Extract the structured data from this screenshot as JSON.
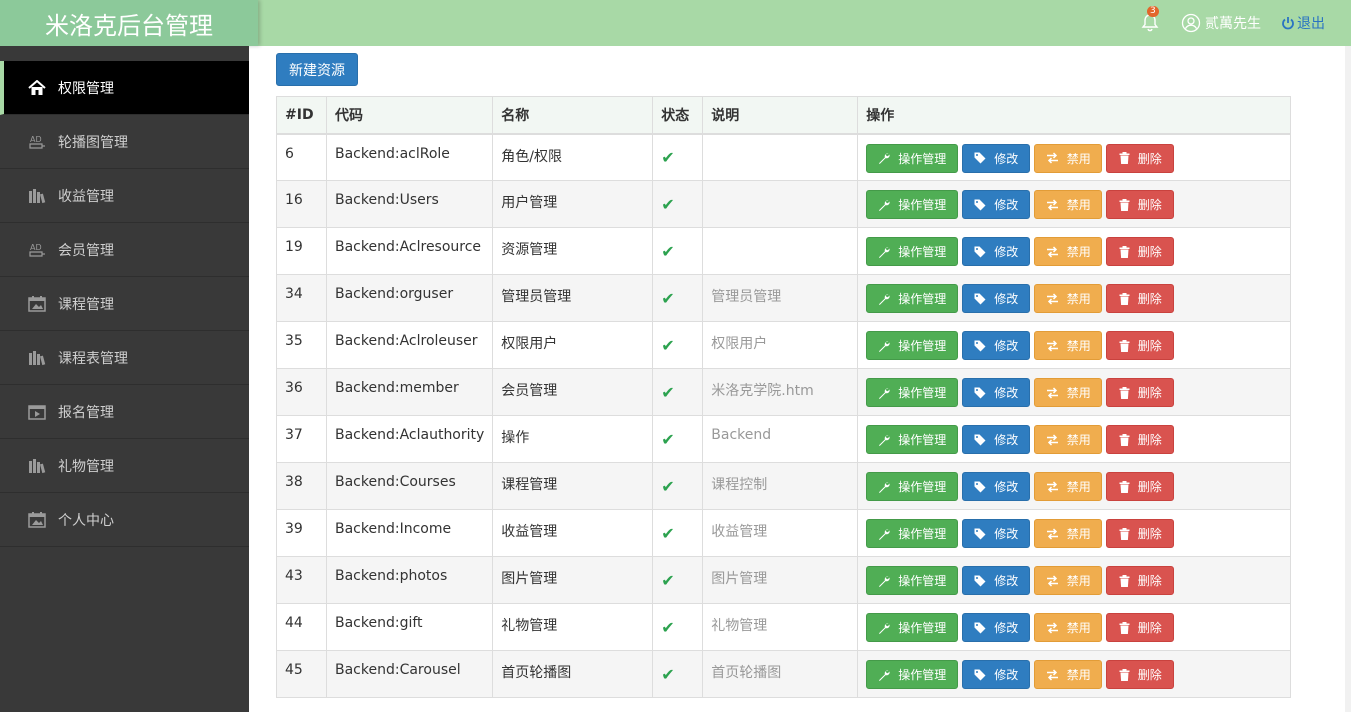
{
  "header": {
    "brand": "米洛克后台管理",
    "notification_count": "3",
    "user_name": "贰萬先生",
    "logout_label": "退出"
  },
  "sidebar": {
    "items": [
      {
        "label": "权限管理",
        "icon": "home-icon",
        "active": true
      },
      {
        "label": "轮播图管理",
        "icon": "ad-icon",
        "active": false
      },
      {
        "label": "收益管理",
        "icon": "library-icon",
        "active": false
      },
      {
        "label": "会员管理",
        "icon": "ad-icon",
        "active": false
      },
      {
        "label": "课程管理",
        "icon": "calendar-icon",
        "active": false
      },
      {
        "label": "课程表管理",
        "icon": "library-icon",
        "active": false
      },
      {
        "label": "报名管理",
        "icon": "video-icon",
        "active": false
      },
      {
        "label": "礼物管理",
        "icon": "library-icon",
        "active": false
      },
      {
        "label": "个人中心",
        "icon": "calendar-icon",
        "active": false
      }
    ]
  },
  "toolbar": {
    "new_label": "新建资源"
  },
  "table": {
    "headers": {
      "id": "#ID",
      "code": "代码",
      "name": "名称",
      "status": "状态",
      "desc": "说明",
      "ops": "操作"
    },
    "actions": {
      "manage": "操作管理",
      "edit": "修改",
      "disable": "禁用",
      "delete": "删除"
    },
    "status_mark": "✔",
    "rows": [
      {
        "id": "6",
        "code": "Backend:aclRole",
        "name": "角色/权限",
        "desc": ""
      },
      {
        "id": "16",
        "code": "Backend:Users",
        "name": "用户管理",
        "desc": ""
      },
      {
        "id": "19",
        "code": "Backend:Aclresource",
        "name": "资源管理",
        "desc": ""
      },
      {
        "id": "34",
        "code": "Backend:orguser",
        "name": "管理员管理",
        "desc": "管理员管理"
      },
      {
        "id": "35",
        "code": "Backend:Aclroleuser",
        "name": "权限用户",
        "desc": "权限用户"
      },
      {
        "id": "36",
        "code": "Backend:member",
        "name": "会员管理",
        "desc": "米洛克学院.htm"
      },
      {
        "id": "37",
        "code": "Backend:Aclauthority",
        "name": "操作",
        "desc": "Backend"
      },
      {
        "id": "38",
        "code": "Backend:Courses",
        "name": "课程管理",
        "desc": "课程控制"
      },
      {
        "id": "39",
        "code": "Backend:Income",
        "name": "收益管理",
        "desc": "收益管理"
      },
      {
        "id": "43",
        "code": "Backend:photos",
        "name": "图片管理",
        "desc": "图片管理"
      },
      {
        "id": "44",
        "code": "Backend:gift",
        "name": "礼物管理",
        "desc": "礼物管理"
      },
      {
        "id": "45",
        "code": "Backend:Carousel",
        "name": "首页轮播图",
        "desc": "首页轮播图"
      }
    ]
  },
  "colors": {
    "header": "#a8d9a6",
    "sidebar": "#393939",
    "primary": "#2f7dc0",
    "success": "#50ae55",
    "warning": "#f0ad4e",
    "danger": "#d9534f"
  }
}
